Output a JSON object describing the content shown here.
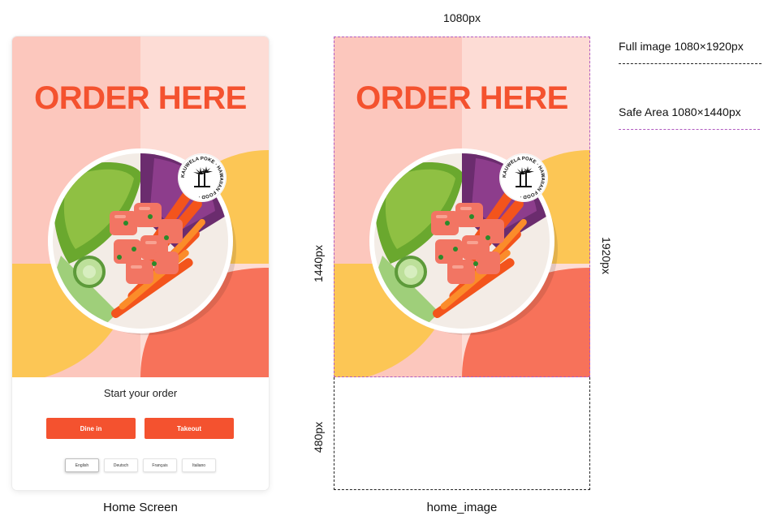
{
  "home_screen": {
    "hero_title": "ORDER HERE",
    "badge_text": "KAUWELA POKE · HAWAIIAN FOOD ·",
    "start_label": "Start your order",
    "buttons": {
      "dine_in": "Dine in",
      "takeout": "Takeout"
    },
    "languages": [
      "English",
      "Deutsch",
      "Français",
      "Italiano"
    ],
    "selected_language": "English",
    "caption": "Home Screen"
  },
  "spec": {
    "hero_title": "ORDER HERE",
    "caption": "home_image",
    "width_label": "1080px",
    "safe_height_label": "1440px",
    "bottom_height_label": "480px",
    "full_height_label": "1920px",
    "legend": {
      "full_image": "Full image 1080×1920px",
      "safe_area": "Safe Area 1080×1440px"
    }
  },
  "colors": {
    "accent": "#f4522f",
    "pink_light": "#fddcd5",
    "pink": "#fcc7bd",
    "yellow": "#fcc655",
    "coral": "#f7725a",
    "safe_area_line": "#b15bc1"
  }
}
